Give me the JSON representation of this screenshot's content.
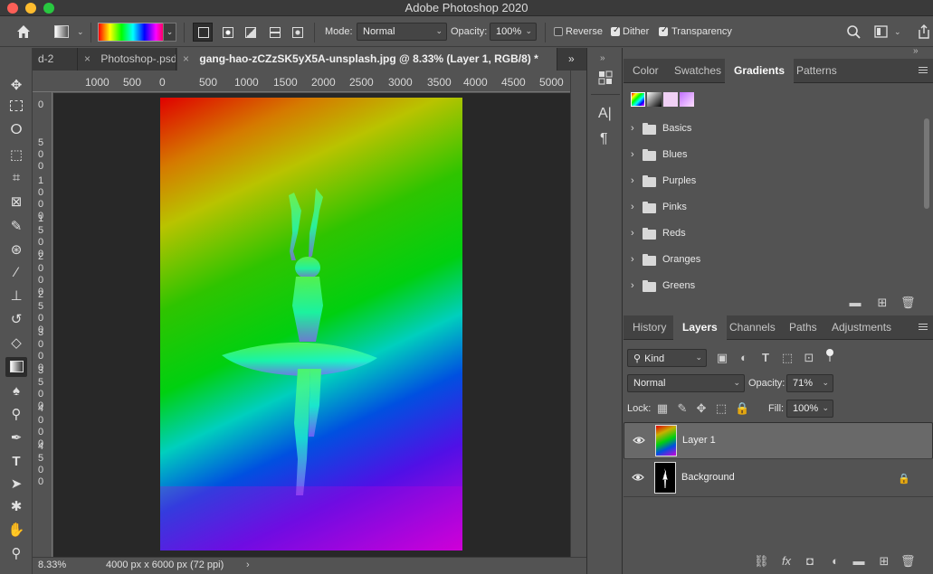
{
  "app": {
    "title": "Adobe Photoshop 2020"
  },
  "options": {
    "mode_label": "Mode:",
    "mode_value": "Normal",
    "opacity_label": "Opacity:",
    "opacity_value": "100%",
    "reverse_label": "Reverse",
    "dither_label": "Dither",
    "transparency_label": "Transparency",
    "reverse_checked": false,
    "dither_checked": true,
    "transparency_checked": true
  },
  "tabs": [
    {
      "label": "d-2"
    },
    {
      "label": "Photoshop-.psd"
    },
    {
      "label": "gang-hao-zCZzSK5yX5A-unsplash.jpg @ 8.33% (Layer 1, RGB/8) *"
    }
  ],
  "tab_close_glyph": "×",
  "ruler": {
    "top": [
      "1000",
      "500",
      "0",
      "500",
      "1000",
      "1500",
      "2000",
      "2500",
      "3000",
      "3500",
      "4000",
      "4500",
      "5000"
    ],
    "left": [
      "0",
      "5\n0\n0",
      "1\n0\n0\n0",
      "1\n5\n0\n0",
      "2\n0\n0\n0",
      "2\n5\n0\n0",
      "3\n0\n0\n0",
      "3\n5\n0\n0",
      "4\n0\n0\n0",
      "4\n5\n0\n0"
    ]
  },
  "status": {
    "zoom": "8.33%",
    "doc_info": "4000 px x 6000 px (72 ppi)",
    "arrow": "›"
  },
  "gradient_panel": {
    "tabs": [
      "Color",
      "Swatches",
      "Gradients",
      "Patterns"
    ],
    "active_tab": "Gradients",
    "folders": [
      "Basics",
      "Blues",
      "Purples",
      "Pinks",
      "Reds",
      "Oranges",
      "Greens"
    ]
  },
  "layers_panel": {
    "tabs": [
      "History",
      "Layers",
      "Channels",
      "Paths",
      "Adjustments"
    ],
    "active_tab": "Layers",
    "kind_label": "Kind",
    "blend_mode": "Normal",
    "opacity_label": "Opacity:",
    "opacity_value": "71%",
    "lock_label": "Lock:",
    "fill_label": "Fill:",
    "fill_value": "100%",
    "layers": [
      {
        "name": "Layer 1",
        "selected": true
      },
      {
        "name": "Background",
        "selected": false,
        "locked": true
      }
    ]
  },
  "colors": {
    "accent_bg": "#535353",
    "canvas_bg": "#282828",
    "panel_tab_bg": "#424242"
  }
}
